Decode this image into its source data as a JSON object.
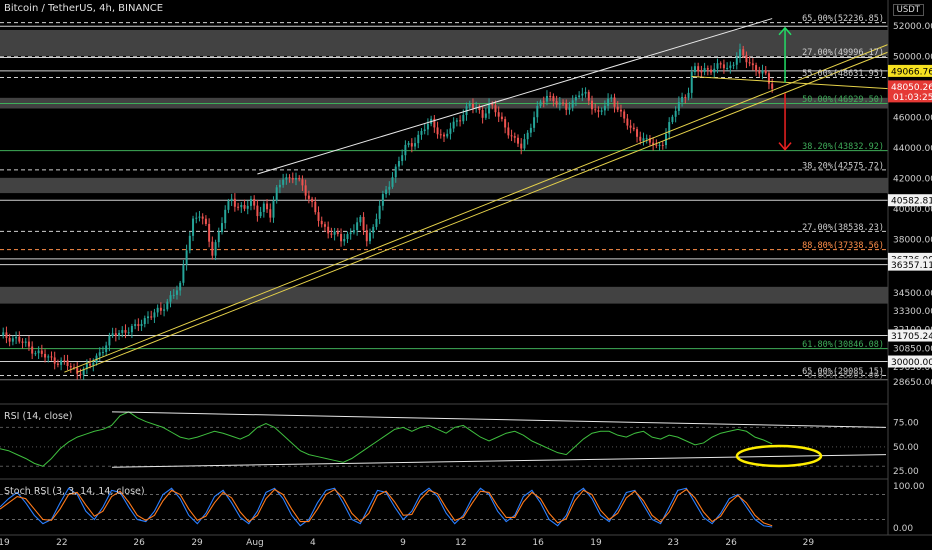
{
  "header": {
    "title": "Bitcoin / TetherUS, 4h, BINANCE",
    "currency": "USDT"
  },
  "panes": {
    "rsi_label": "RSI (14, close)",
    "stoch_label": "Stoch RSI (3, 3, 14, 14, close)"
  },
  "colors": {
    "background": "#000000",
    "candle_up": "#26a69a",
    "candle_down": "#ef5350",
    "fib_green": "#3fae5a",
    "fib_orange": "#ff8f4a",
    "channel_white": "#e8e8e8",
    "trend_yellow": "#e6d24a",
    "rsi_line": "#3fbf3f",
    "stoch_k": "#2a7fff",
    "stoch_d": "#ff7a1a",
    "ellipse": "#ffee00",
    "arrow_up": "#22dd66",
    "arrow_down": "#ee2222"
  },
  "chart_data": [
    {
      "type": "candlestick",
      "pane": "price",
      "ylim": [
        28000,
        52800
      ],
      "x_tick_labels": [
        "19",
        "22",
        "26",
        "29",
        "Aug",
        "4",
        "9",
        "12",
        "16",
        "19",
        "23",
        "26",
        "29"
      ],
      "y_tick_labels": [
        52000,
        50000,
        48000,
        46000,
        44000,
        42000,
        40000,
        38000,
        34500,
        33300,
        32100,
        30850,
        29650,
        28650
      ],
      "price_badges": [
        {
          "value": "49066.76",
          "style": "yellow"
        },
        {
          "value": "48050.26",
          "time": "01:03:25",
          "style": "red"
        },
        {
          "value": "40582.81",
          "style": "white"
        },
        {
          "value": "36736.00",
          "style": "white"
        },
        {
          "value": "36357.11",
          "style": "white"
        },
        {
          "value": "31705.24",
          "style": "white"
        },
        {
          "value": "30000.00",
          "style": "white"
        }
      ],
      "levels": [
        {
          "label": "65.00%(52236.85)",
          "price": 52236.85,
          "color": "white",
          "dashed": true
        },
        {
          "label": "27.00%(49996.17)",
          "price": 49996.17,
          "color": "white",
          "dashed": true
        },
        {
          "label": "55.00%(48631.95)",
          "price": 48631.95,
          "color": "white",
          "dashed": true
        },
        {
          "label": "50.00%(46929.50)",
          "price": 46929.5,
          "color": "green",
          "dashed": false
        },
        {
          "label": "38.20%(43832.92)",
          "price": 43832.92,
          "color": "green",
          "dashed": false
        },
        {
          "label": "38.20%(42575.72)",
          "price": 42575.72,
          "color": "white",
          "dashed": true
        },
        {
          "label": "27.00%(38538.23)",
          "price": 38538.23,
          "color": "white",
          "dashed": true
        },
        {
          "label": "88.80%(37338.56)",
          "price": 37338.56,
          "color": "orange",
          "dashed": true
        },
        {
          "label": "61.80%(30846.08)",
          "price": 30846.08,
          "color": "green",
          "dashed": false
        },
        {
          "label": "65.00%(29085.15)",
          "price": 29085.15,
          "color": "white",
          "dashed": true
        },
        {
          "label": "0.00%(28805.00)",
          "price": 28805.0,
          "color": "grey",
          "dashed": false
        }
      ],
      "solid_lines": [
        52000,
        49950,
        49066.76,
        40582.81,
        36736.0,
        36357.11,
        31705.24,
        30000.0
      ],
      "zones": [
        [
          50050,
          51750
        ],
        [
          46600,
          47300
        ],
        [
          41050,
          42050
        ],
        [
          33800,
          34900
        ]
      ],
      "close_path": [
        [
          0,
          31700
        ],
        [
          5,
          31500
        ],
        [
          10,
          30800
        ],
        [
          15,
          30200
        ],
        [
          20,
          29900
        ],
        [
          24,
          29300
        ],
        [
          28,
          29700
        ],
        [
          31,
          30600
        ],
        [
          35,
          31700
        ],
        [
          38,
          32000
        ],
        [
          42,
          32200
        ],
        [
          46,
          33000
        ],
        [
          50,
          33300
        ],
        [
          53,
          34300
        ],
        [
          56,
          34900
        ],
        [
          58,
          37500
        ],
        [
          60,
          39300
        ],
        [
          62,
          39600
        ],
        [
          64,
          38800
        ],
        [
          66,
          37200
        ],
        [
          68,
          38400
        ],
        [
          70,
          39900
        ],
        [
          72,
          40700
        ],
        [
          74,
          40200
        ],
        [
          76,
          40000
        ],
        [
          78,
          40500
        ],
        [
          80,
          39800
        ],
        [
          82,
          40200
        ],
        [
          84,
          39500
        ],
        [
          85,
          40500
        ],
        [
          86,
          41300
        ],
        [
          88,
          42200
        ],
        [
          90,
          41800
        ],
        [
          92,
          42100
        ],
        [
          94,
          41600
        ],
        [
          96,
          40700
        ],
        [
          98,
          39700
        ],
        [
          100,
          39000
        ],
        [
          102,
          38600
        ],
        [
          104,
          38300
        ],
        [
          106,
          38000
        ],
        [
          108,
          38300
        ],
        [
          110,
          38800
        ],
        [
          112,
          39200
        ],
        [
          114,
          38100
        ],
        [
          116,
          38800
        ],
        [
          118,
          40200
        ],
        [
          120,
          41200
        ],
        [
          122,
          42200
        ],
        [
          124,
          43200
        ],
        [
          126,
          44000
        ],
        [
          128,
          44300
        ],
        [
          130,
          44800
        ],
        [
          132,
          45300
        ],
        [
          134,
          45700
        ],
        [
          136,
          45200
        ],
        [
          138,
          44600
        ],
        [
          140,
          45300
        ],
        [
          142,
          45800
        ],
        [
          144,
          46300
        ],
        [
          146,
          46800
        ],
        [
          148,
          46600
        ],
        [
          150,
          46200
        ],
        [
          152,
          46800
        ],
        [
          154,
          46400
        ],
        [
          156,
          45800
        ],
        [
          158,
          45100
        ],
        [
          160,
          44400
        ],
        [
          162,
          44100
        ],
        [
          164,
          45000
        ],
        [
          166,
          46100
        ],
        [
          168,
          46900
        ],
        [
          170,
          47500
        ],
        [
          172,
          47200
        ],
        [
          174,
          46800
        ],
        [
          176,
          46600
        ],
        [
          178,
          47100
        ],
        [
          180,
          47600
        ],
        [
          182,
          47400
        ],
        [
          184,
          46800
        ],
        [
          186,
          46300
        ],
        [
          188,
          46800
        ],
        [
          190,
          47200
        ],
        [
          192,
          46700
        ],
        [
          194,
          45900
        ],
        [
          196,
          45200
        ],
        [
          198,
          44900
        ],
        [
          200,
          44600
        ],
        [
          202,
          44400
        ],
        [
          204,
          44000
        ],
        [
          206,
          44500
        ],
        [
          208,
          45500
        ],
        [
          210,
          46500
        ],
        [
          212,
          47300
        ],
        [
          214,
          47800
        ],
        [
          215,
          48800
        ],
        [
          216,
          49200
        ],
        [
          218,
          49000
        ],
        [
          220,
          49300
        ],
        [
          222,
          49100
        ],
        [
          224,
          49500
        ],
        [
          226,
          49200
        ],
        [
          228,
          49700
        ],
        [
          230,
          50200
        ],
        [
          232,
          49800
        ],
        [
          234,
          49400
        ],
        [
          236,
          49000
        ],
        [
          238,
          48700
        ],
        [
          240,
          48050
        ]
      ],
      "annotations": [
        {
          "kind": "channel_upper",
          "from": [
            80,
            42300
          ],
          "to": [
            240,
            52500
          ]
        },
        {
          "kind": "trend_yellow",
          "from": [
            20,
            29300
          ],
          "to": [
            276,
            50800
          ]
        },
        {
          "kind": "trend_yellow",
          "from": [
            24,
            29300
          ],
          "to": [
            276,
            50300
          ]
        },
        {
          "kind": "trend_yellow_short",
          "from": [
            215,
            48700
          ],
          "to": [
            276,
            47900
          ]
        },
        {
          "kind": "arrow_up",
          "x": 244,
          "from": 48300,
          "to": 51900
        },
        {
          "kind": "arrow_down",
          "x": 244,
          "from": 47600,
          "to": 43900
        }
      ]
    },
    {
      "type": "line",
      "pane": "rsi",
      "series": [
        {
          "name": "RSI (14, close)",
          "values": [
            48,
            46,
            42,
            38,
            33,
            30,
            38,
            48,
            55,
            60,
            63,
            66,
            68,
            72,
            82,
            86,
            80,
            76,
            73,
            70,
            65,
            60,
            58,
            60,
            63,
            66,
            64,
            61,
            58,
            62,
            70,
            74,
            70,
            62,
            54,
            46,
            42,
            40,
            38,
            36,
            34,
            38,
            44,
            50,
            56,
            62,
            68,
            70,
            66,
            70,
            72,
            68,
            64,
            70,
            72,
            66,
            60,
            56,
            60,
            64,
            66,
            62,
            56,
            52,
            48,
            44,
            42,
            50,
            58,
            64,
            66,
            66,
            62,
            60,
            64,
            66,
            60,
            58,
            62,
            60,
            56,
            52,
            54,
            60,
            64,
            66,
            68,
            66,
            60,
            57,
            53
          ]
        }
      ],
      "y_tick_labels": [
        75.0,
        50.0,
        25.0
      ],
      "ylim": [
        20,
        92
      ],
      "annotations": [
        {
          "kind": "trend_upper",
          "from": [
            0,
            86
          ],
          "to": [
            1,
            70
          ]
        },
        {
          "kind": "trend_lower",
          "from": [
            0,
            29
          ],
          "to": [
            1,
            42
          ]
        }
      ]
    },
    {
      "type": "line",
      "pane": "stoch_rsi",
      "series": [
        {
          "name": "K",
          "values": [
            50,
            70,
            85,
            60,
            30,
            10,
            20,
            60,
            95,
            80,
            40,
            20,
            50,
            90,
            85,
            50,
            20,
            15,
            40,
            80,
            95,
            70,
            30,
            10,
            35,
            75,
            90,
            60,
            25,
            10,
            40,
            85,
            95,
            70,
            30,
            5,
            20,
            60,
            90,
            95,
            60,
            20,
            10,
            50,
            90,
            85,
            50,
            20,
            40,
            80,
            95,
            75,
            35,
            10,
            30,
            70,
            95,
            80,
            40,
            15,
            30,
            75,
            90,
            60,
            20,
            5,
            30,
            80,
            95,
            70,
            30,
            15,
            45,
            85,
            90,
            55,
            20,
            10,
            50,
            90,
            95,
            60,
            25,
            10,
            35,
            70,
            80,
            50,
            20,
            5,
            2
          ]
        },
        {
          "name": "D",
          "values": [
            45,
            60,
            75,
            70,
            45,
            20,
            18,
            45,
            80,
            85,
            55,
            28,
            40,
            75,
            88,
            62,
            30,
            18,
            30,
            65,
            90,
            80,
            45,
            18,
            28,
            60,
            85,
            72,
            38,
            15,
            30,
            70,
            92,
            80,
            45,
            15,
            15,
            45,
            80,
            92,
            72,
            35,
            15,
            35,
            78,
            88,
            62,
            30,
            32,
            68,
            90,
            82,
            48,
            18,
            25,
            58,
            88,
            85,
            52,
            25,
            25,
            62,
            85,
            70,
            35,
            12,
            22,
            65,
            90,
            80,
            42,
            20,
            35,
            72,
            88,
            65,
            30,
            14,
            38,
            78,
            92,
            72,
            38,
            15,
            28,
            60,
            78,
            60,
            30,
            12,
            5
          ]
        }
      ],
      "y_tick_labels": [
        100.0,
        0.0
      ],
      "ylim": [
        -10,
        110
      ]
    }
  ]
}
